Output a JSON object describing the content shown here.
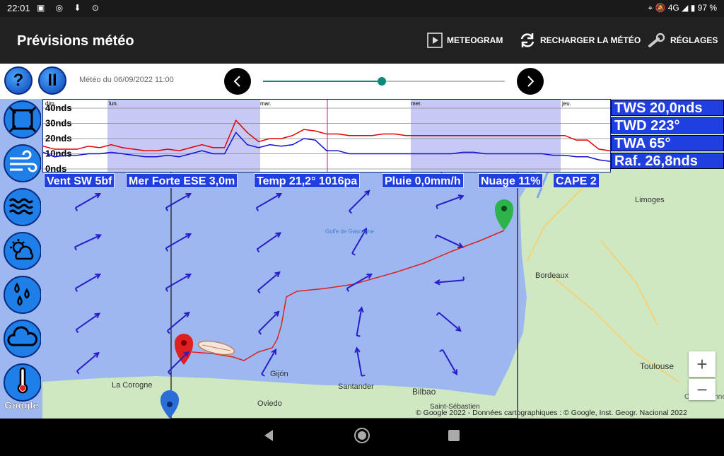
{
  "status": {
    "time": "22:01",
    "network": "4G",
    "battery": "97 %"
  },
  "appbar": {
    "title": "Prévisions météo",
    "meteogram_label": "METEOGRAM",
    "reload_label": "RECHARGER LA MÉTÉO",
    "settings_label": "RÉGLAGES"
  },
  "toolbar": {
    "help_label": "?",
    "pause_label": "II",
    "meteo_label": "Météo du  06/09/2022 11:00",
    "timeline_progress": 0.49
  },
  "meteogram": {
    "y_labels": [
      "40nds",
      "30nds",
      "20nds",
      "10nds",
      "0nds"
    ],
    "day_labels": [
      "dim.",
      "lun.",
      "mar.",
      "mer.",
      "jeu."
    ],
    "chart_data": {
      "type": "line",
      "ylim": [
        0,
        40
      ],
      "x": [
        0,
        2,
        4,
        6,
        8,
        10,
        12,
        14,
        16,
        18,
        20,
        22,
        24,
        26,
        28,
        30,
        32,
        34,
        36,
        38,
        40,
        42,
        44,
        46,
        48,
        50,
        52,
        54,
        56,
        58,
        60,
        62,
        64,
        66,
        68,
        70,
        72,
        74,
        76,
        78,
        80,
        82,
        84,
        86,
        88,
        90,
        92,
        94,
        96,
        98,
        100
      ],
      "series": [
        {
          "name": "Raf.",
          "color": "#e00000",
          "values": [
            15,
            13,
            13,
            13,
            15,
            14,
            16,
            14,
            13,
            12,
            12,
            13,
            12,
            14,
            16,
            14,
            14,
            32,
            24,
            18,
            20,
            20,
            22,
            26,
            25,
            23,
            23,
            22,
            22,
            22,
            23,
            23,
            22,
            22,
            22,
            22,
            22,
            22,
            22,
            22,
            22,
            22,
            22,
            22,
            22,
            22,
            22,
            19,
            19,
            13,
            12
          ]
        },
        {
          "name": "TWS",
          "color": "#1010d0",
          "values": [
            11,
            8,
            9,
            9,
            10,
            10,
            11,
            10,
            9,
            8,
            8,
            9,
            8,
            10,
            12,
            10,
            10,
            24,
            16,
            14,
            16,
            15,
            16,
            20,
            19,
            12,
            12,
            10,
            10,
            10,
            10,
            10,
            10,
            10,
            10,
            10,
            10,
            11,
            11,
            10,
            10,
            10,
            10,
            10,
            10,
            9,
            9,
            8,
            8,
            6,
            5
          ]
        }
      ]
    }
  },
  "stats": [
    "TWS 20,0nds",
    "TWD 223°",
    "TWA 65°",
    "Raf. 26,8nds"
  ],
  "chips": [
    "Vent SW 5bf",
    "Mer Forte ESE 3,0m",
    "Temp 21,2° 1016pa",
    "Pluie 0,0mm/h",
    "Nuage 11%",
    "CAPE 2"
  ],
  "map": {
    "places": [
      "Golfe de Gascogne",
      "Limoges",
      "Bordeaux",
      "Toulouse",
      "Carcassonne",
      "La Corogne",
      "Gijón",
      "Santander",
      "Bilbao",
      "Oviedo",
      "Saint-Sébastien"
    ],
    "attribution": "© Google 2022 - Données cartographiques : © Google, Inst. Geogr. Nacional 2022",
    "logo": "Google",
    "zoom_in": "+",
    "zoom_out": "−"
  },
  "layer_buttons": [
    "routing-layer",
    "wind-layer",
    "waves-layer",
    "sun-cloud-layer",
    "rain-layer",
    "cloud-layer",
    "temperature-layer"
  ],
  "colors": {
    "appbar": "#212121",
    "chip_blue": "#1f3fe0",
    "sea": "#9db8f0",
    "land": "#cfe8c2",
    "route": "#e02020",
    "wind_arrow": "#2a1cc8",
    "slider": "#0a8a78"
  }
}
